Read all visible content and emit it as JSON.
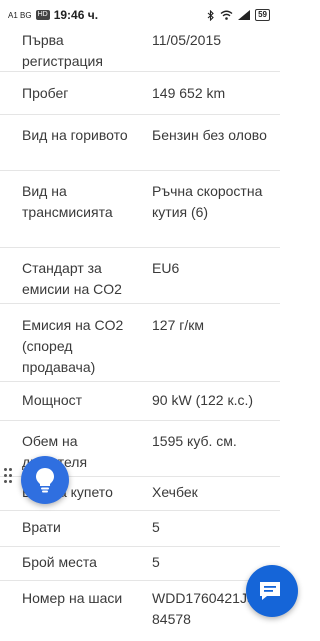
{
  "status_bar": {
    "carrier": "A1 BG",
    "hd": "HD",
    "time": "19:46 ч.",
    "battery": "59"
  },
  "specs": [
    {
      "label": "Първа регистрация",
      "value": "11/05/2015"
    },
    {
      "label": "Пробег",
      "value": "149 652 km"
    },
    {
      "label": "Вид на горивото",
      "value": "Бензин без олово"
    },
    {
      "label": "Вид на трансмисията",
      "value": "Ръчна скоростна кутия (6)"
    },
    {
      "label": "Стандарт за емисии на CO2",
      "value": "EU6"
    },
    {
      "label": "Емисия на CO2 (според продавача)",
      "value": "127 г/км"
    },
    {
      "label": "Мощност",
      "value": "90 kW (122 к.с.)"
    },
    {
      "label": "Обем на двигателя",
      "value": "1595 куб. см."
    },
    {
      "label": "Вид на купето",
      "value": "Хечбек"
    },
    {
      "label": "Врати",
      "value": "5"
    },
    {
      "label": "Брой места",
      "value": "5"
    },
    {
      "label": "Номер на шаси",
      "value": "WDD1760421J584578"
    }
  ],
  "icons": {
    "bulb": "lightbulb-icon",
    "chat": "chat-icon",
    "drag": "drag-handle-icon"
  },
  "colors": {
    "accent": "#2f6fe0",
    "chat": "#1565d8"
  }
}
